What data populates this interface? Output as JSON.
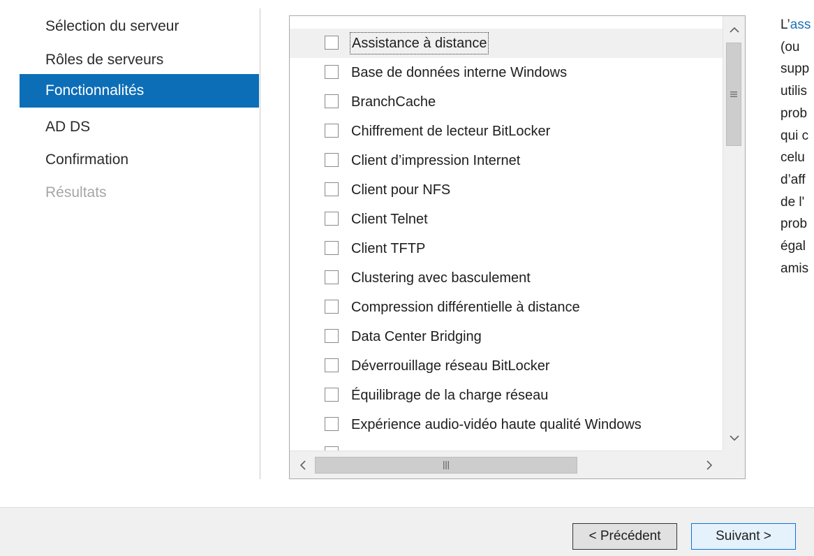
{
  "nav": {
    "items": [
      {
        "label": "Sélection du serveur",
        "state": "normal"
      },
      {
        "label": "Rôles de serveurs",
        "state": "normal"
      },
      {
        "label": "Fonctionnalités",
        "state": "active"
      },
      {
        "label": "AD DS",
        "state": "normal"
      },
      {
        "label": "Confirmation",
        "state": "normal"
      },
      {
        "label": "Résultats",
        "state": "disabled"
      }
    ]
  },
  "features": {
    "items": [
      {
        "label": "Assistance à distance",
        "checked": false,
        "selected": true
      },
      {
        "label": "Base de données interne Windows",
        "checked": false
      },
      {
        "label": "BranchCache",
        "checked": false
      },
      {
        "label": "Chiffrement de lecteur BitLocker",
        "checked": false
      },
      {
        "label": "Client d’impression Internet",
        "checked": false
      },
      {
        "label": "Client pour NFS",
        "checked": false
      },
      {
        "label": "Client Telnet",
        "checked": false
      },
      {
        "label": "Client TFTP",
        "checked": false
      },
      {
        "label": "Clustering avec basculement",
        "checked": false
      },
      {
        "label": "Compression différentielle à distance",
        "checked": false
      },
      {
        "label": "Data Center Bridging",
        "checked": false
      },
      {
        "label": "Déverrouillage réseau BitLocker",
        "checked": false
      },
      {
        "label": "Équilibrage de la charge réseau",
        "checked": false
      },
      {
        "label": "Expérience audio-vidéo haute qualité Windows",
        "checked": false
      }
    ]
  },
  "description": {
    "lines": [
      {
        "prefix": "L’",
        "link": "ass"
      },
      {
        "text": "(ou"
      },
      {
        "text": "supp"
      },
      {
        "text": "utilis"
      },
      {
        "text": "prob"
      },
      {
        "text": "qui c"
      },
      {
        "text": "celu"
      },
      {
        "text": "d’aff"
      },
      {
        "text": "de l'"
      },
      {
        "text": "prob"
      },
      {
        "text": "égal"
      },
      {
        "text": "amis"
      }
    ]
  },
  "footer": {
    "prev_label": "< Précédent",
    "next_label": "Suivant >"
  },
  "icons": {
    "scroll_up": "chevron-up-icon",
    "scroll_down": "chevron-down-icon",
    "scroll_left": "chevron-left-icon",
    "scroll_right": "chevron-right-icon",
    "grip": "grip-icon"
  },
  "colors": {
    "active_nav": "#0d6eb8",
    "link": "#1e6fb3",
    "next_border": "#0b74d8"
  }
}
